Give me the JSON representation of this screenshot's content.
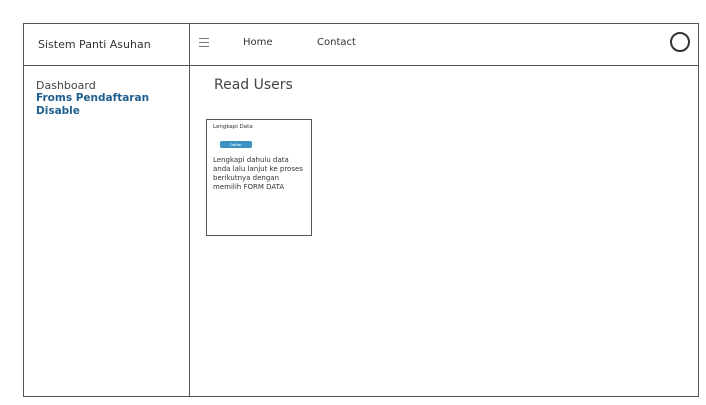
{
  "app": {
    "title": "Sistem Panti Asuhan"
  },
  "nav": {
    "home": "Home",
    "contact": "Contact"
  },
  "sidebar": {
    "items": [
      {
        "label": "Dashboard"
      },
      {
        "label": "Froms Pendaftaran"
      },
      {
        "label": "Disable"
      }
    ]
  },
  "main": {
    "title": "Read Users",
    "card": {
      "title": "Lengkapi Data",
      "button_label": "Daftar",
      "text": "Lengkapi dahulu data anda lalu lanjut ke proses berikutnya dengan memilih FORM DATA"
    }
  },
  "colors": {
    "border": "#555555",
    "accent_blue": "#3b92c2",
    "active_link": "#1f5f8f"
  }
}
